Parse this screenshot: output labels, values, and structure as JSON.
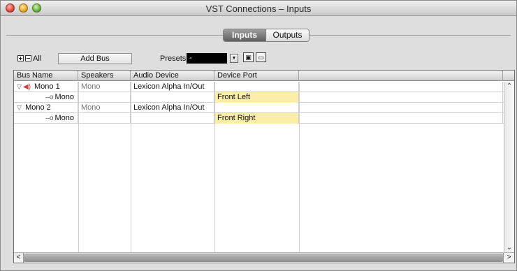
{
  "window": {
    "title": "VST Connections – Inputs"
  },
  "tabs": [
    {
      "label": "Inputs",
      "active": true
    },
    {
      "label": "Outputs",
      "active": false
    }
  ],
  "toolbar": {
    "all_label": "All",
    "add_bus_label": "Add Bus",
    "presets_label": "Presets",
    "presets_value": "-"
  },
  "table": {
    "headers": [
      "Bus Name",
      "Speakers",
      "Audio Device",
      "Device Port"
    ],
    "rows": [
      {
        "bus": "Mono 1",
        "speakers": "Mono",
        "device": "Lexicon Alpha In/Out",
        "port": ""
      },
      {
        "bus": "Mono",
        "speakers": "",
        "device": "",
        "port": "Front Left"
      },
      {
        "bus": "Mono 2",
        "speakers": "Mono",
        "device": "Lexicon Alpha In/Out",
        "port": ""
      },
      {
        "bus": "Mono",
        "speakers": "",
        "device": "",
        "port": "Front Right"
      }
    ]
  },
  "colors": {
    "port_highlight": "#fbeea6",
    "active_tab": "#6a6a6a"
  }
}
